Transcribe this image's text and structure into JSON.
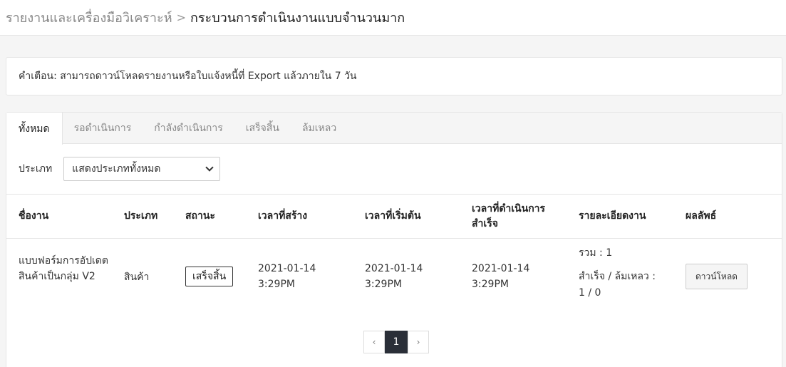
{
  "breadcrumb": {
    "parent": "รายงานและเครื่องมือวิเคราะห์",
    "separator": ">",
    "current": "กระบวนการดำเนินงานแบบจำนวนมาก"
  },
  "notice": "คำเตือน: สามารถดาวน์โหลดรายงานหรือใบแจ้งหนี้ที่ Export แล้วภายใน 7 วัน",
  "tabs": [
    {
      "label": "ทั้งหมด",
      "active": true
    },
    {
      "label": "รอดำเนินการ",
      "active": false
    },
    {
      "label": "กำลังดำเนินการ",
      "active": false
    },
    {
      "label": "เสร็จสิ้น",
      "active": false
    },
    {
      "label": "ล้มเหลว",
      "active": false
    }
  ],
  "filter": {
    "label": "ประเภท",
    "selected": "แสดงประเภททั้งหมด"
  },
  "table": {
    "headers": [
      "ชื่องาน",
      "ประเภท",
      "สถานะ",
      "เวลาที่สร้าง",
      "เวลาที่เริ่มต้น",
      "เวลาที่ดำเนินการสำเร็จ",
      "รายละเอียดงาน",
      "ผลลัพธ์"
    ],
    "rows": [
      {
        "name": "แบบฟอร์มการอัปเดตสินค้าเป็นกลุ่ม V2",
        "type": "สินค้า",
        "status": "เสร็จสิ้น",
        "created": "2021-01-14 3:29PM",
        "started": "2021-01-14 3:29PM",
        "completed": "2021-01-14 3:29PM",
        "details_total": "รวม : 1",
        "details_result_label": "สำเร็จ / ล้มเหลว :",
        "details_result_value": "1 / 0",
        "action": "ดาวน์โหลด"
      }
    ]
  },
  "pagination": {
    "prev": "‹",
    "current": "1",
    "next": "›"
  }
}
